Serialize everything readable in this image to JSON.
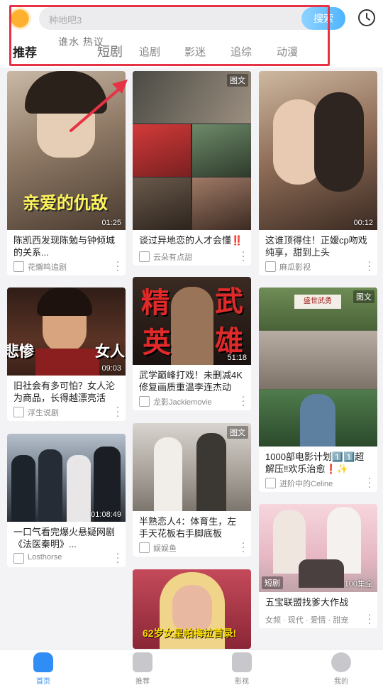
{
  "header": {
    "search_placeholder": "种地吧3",
    "search_button": "搜索",
    "tabs": [
      {
        "label": "推荐"
      },
      {
        "label": "谁水 热议"
      },
      {
        "label": "短剧"
      },
      {
        "label": "追剧"
      },
      {
        "label": "影迷"
      },
      {
        "label": "追综"
      },
      {
        "label": "动漫"
      }
    ]
  },
  "feed": {
    "col1": [
      {
        "title": "陈凯西发现陈勉与钟倾城的关系...",
        "author": "花懒鸣追剧",
        "duration": "01:25",
        "overlay": "亲爱的仇敌"
      },
      {
        "title": "旧社会有多可怕？女人沦为商品，长得越漂亮活得...",
        "author": "浮生说剧",
        "duration": "09:03",
        "overlay_left": "悲惨",
        "overlay_right": "女人"
      },
      {
        "title": "一口气看完爆火悬疑网剧《法医秦明》...",
        "author": "Losthorse",
        "duration": "01:08:49"
      }
    ],
    "col2": [
      {
        "title": "谈过异地恋的人才会懂‼️",
        "author": "云朵有点甜",
        "tag": "图文"
      },
      {
        "title": "武学巅峰打戏！未删减4K修复画质重温李连杰动作...",
        "author": "龙影Jackiemovie",
        "duration": "51:18",
        "overlay_a": "精",
        "overlay_b": "武",
        "overlay_c": "英",
        "overlay_d": "雄"
      },
      {
        "title": "半熟恋人4：体育生，左手天花板右手脚底板",
        "author": "娱娱鱼",
        "tag": "图文"
      },
      {
        "overlay": "62岁女星帕梅拉首录!"
      }
    ],
    "col3": [
      {
        "title": "这谁顶得住！正嫒cp吻戏纯享，甜到上头",
        "author": "麻瓜影视",
        "duration": "00:12"
      },
      {
        "title": "1000部电影计划1️⃣1️⃣超解压‼欢乐治愈❗✨",
        "author": "进阶中的Celine",
        "tag": "图文",
        "sign": "盛世武勇"
      },
      {
        "title": "五宝联盟找爹大作战",
        "author": "女频 · 现代 · 爱情 · 甜宠",
        "tag_left": "短剧",
        "tag": "100集全"
      }
    ]
  },
  "nav": {
    "items": [
      {
        "label": "首页"
      },
      {
        "label": "推荐"
      },
      {
        "label": "影视"
      },
      {
        "label": "我的"
      }
    ]
  },
  "colors": {
    "accent": "#2f8df5",
    "highlight": "#e63244"
  }
}
